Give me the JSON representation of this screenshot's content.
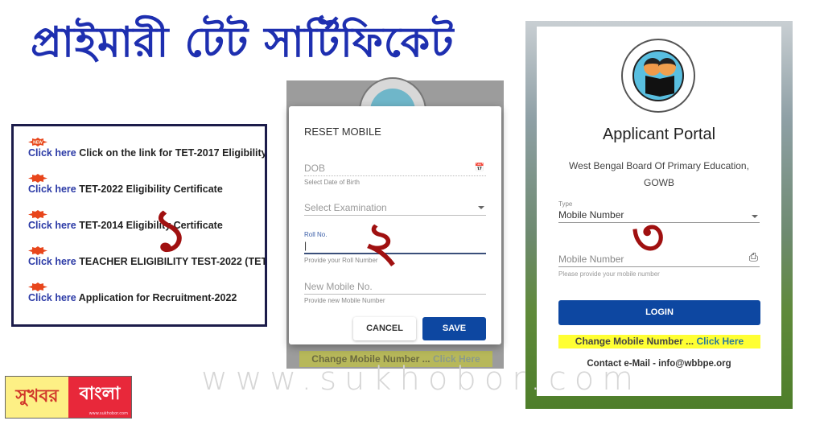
{
  "headline": "প্রাইমারী টেট সার্টিফিকেট",
  "panel1": {
    "badge": "NEW",
    "link_label": "Click here",
    "items": [
      {
        "text": "Click on the link for TET-2017 Eligibility"
      },
      {
        "text": "TET-2022 Eligibility Certificate"
      },
      {
        "text": "TET-2014 Eligibility Certificate"
      },
      {
        "text": "TEACHER ELIGIBILITY TEST-2022 (TET"
      },
      {
        "text": "Application for Recruitment-2022"
      }
    ],
    "annotation": "১"
  },
  "panel2": {
    "dialog_title": "RESET MOBILE",
    "dob": {
      "placeholder": "DOB",
      "hint": "Select Date of Birth",
      "icon": "calendar-icon"
    },
    "exam": {
      "placeholder": "Select Examination"
    },
    "roll": {
      "label": "Roll No.",
      "value": "",
      "hint": "Provide your Roll Number"
    },
    "mobile": {
      "placeholder": "New Mobile No.",
      "hint": "Provide new Mobile Number"
    },
    "cancel_label": "CANCEL",
    "save_label": "SAVE",
    "bg_link_text": "Change Mobile Number ...",
    "bg_link_action": "Click Here",
    "annotation": "২"
  },
  "panel3": {
    "title": "Applicant Portal",
    "subtitle": "West Bengal Board Of Primary Education, GOWB",
    "type_label": "Type",
    "type_value": "Mobile Number",
    "mobile_placeholder": "Mobile Number",
    "mobile_hint": "Please provide your mobile number",
    "login_label": "LOGIN",
    "change_text": "Change Mobile Number ...",
    "change_action": "Click Here",
    "contact": "Contact e-Mail - info@wbbpe.org",
    "annotation": "৩",
    "accent": "#0d47a1"
  },
  "watermark": "www.sukhobor.com",
  "brand": {
    "left": "সুখবর",
    "right": "বাংলা",
    "url": "www.sukhobor.com"
  }
}
